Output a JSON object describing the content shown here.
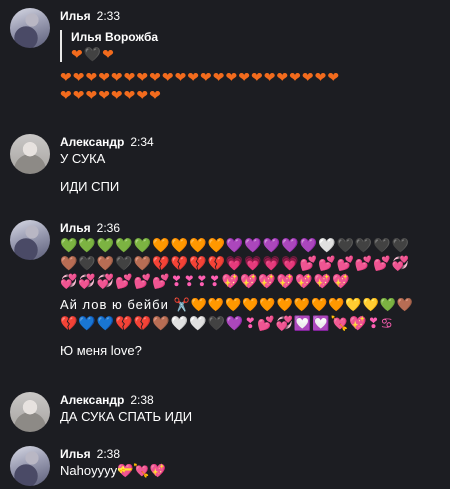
{
  "messages": [
    {
      "author": "Илья",
      "time": "2:33",
      "quote": {
        "author": "Илья Ворожба",
        "emojis": "❤🖤❤"
      },
      "lines": [
        "❤❤❤❤❤❤❤❤❤❤❤❤❤❤❤❤❤❤❤❤❤❤",
        "❤❤❤❤❤❤❤❤"
      ]
    },
    {
      "author": "Александр",
      "time": "2:34",
      "lines": [
        "У СУКА",
        "",
        "ИДИ СПИ"
      ]
    },
    {
      "author": "Илья",
      "time": "2:36",
      "emoji_rows": [
        "💚💚💚💚💚🧡🧡🧡🧡💜💜💜💜💜🤍🖤🖤🖤🖤",
        "🤎🖤🤎🖤🤎💔💔💔💔💗💗💗💗💕💕💕💕💕💞",
        "💞💞💞💕💕💕❣❣❣❣💖💖💖💖💖💖💖",
        "Ай лов ю бейби ✂️🧡🧡🧡🧡🧡🧡🧡🧡🧡💛💛💚🤎",
        "💔💙💙💔💔🤎🤍🤍🖤💜❣💕💞💟💟💘💖❣♋"
      ],
      "text_line": "Ю меня love?"
    },
    {
      "author": "Александр",
      "time": "2:38",
      "lines": [
        "ДА СУКА СПАТЬ ИДИ"
      ]
    },
    {
      "author": "Илья",
      "time": "2:38",
      "lines": [
        "Nahoyyyy💝💘💖"
      ]
    }
  ]
}
